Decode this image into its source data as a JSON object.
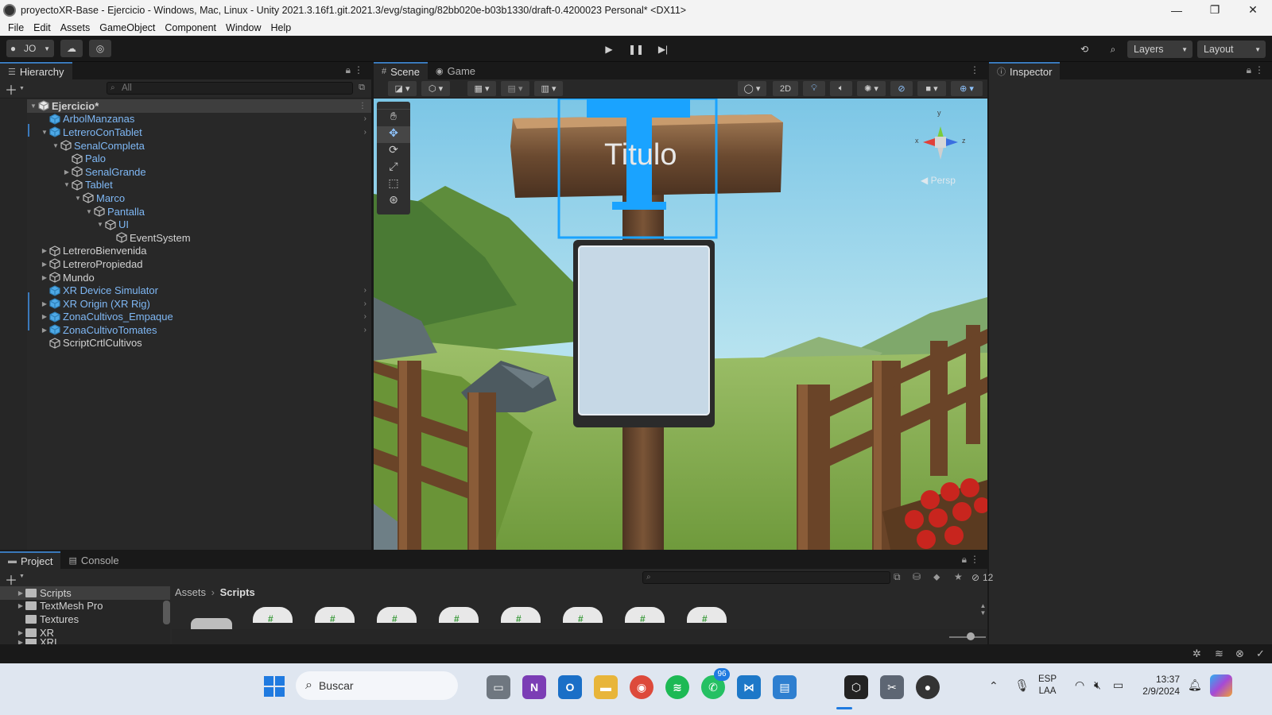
{
  "window": {
    "title": "proyectoXR-Base - Ejercicio - Windows, Mac, Linux - Unity 2021.3.16f1.git.2021.3/evg/staging/82bb020e-b03b1330/draft-0.4200023 Personal* <DX11>",
    "minimize": "—",
    "maximize": "❐",
    "close": "✕"
  },
  "menu": [
    "File",
    "Edit",
    "Assets",
    "GameObject",
    "Component",
    "Window",
    "Help"
  ],
  "toolbar": {
    "account": "JO",
    "layers": "Layers",
    "layout": "Layout"
  },
  "hierarchy": {
    "tab": "Hierarchy",
    "search_placeholder": "All",
    "items": [
      {
        "label": "Ejercicio*",
        "depth": 0,
        "arrow": "▼",
        "kind": "scene",
        "blue": false,
        "selected": true
      },
      {
        "label": "ArbolManzanas",
        "depth": 1,
        "arrow": "",
        "kind": "prefab",
        "blue": true,
        "chevron": true
      },
      {
        "label": "LetreroConTablet",
        "depth": 1,
        "arrow": "▼",
        "kind": "prefab",
        "blue": true,
        "chevron": true
      },
      {
        "label": "SenalCompleta",
        "depth": 2,
        "arrow": "▼",
        "kind": "obj",
        "blue": true
      },
      {
        "label": "Palo",
        "depth": 3,
        "arrow": "",
        "kind": "obj",
        "blue": true
      },
      {
        "label": "SenalGrande",
        "depth": 3,
        "arrow": "▶",
        "kind": "obj",
        "blue": true
      },
      {
        "label": "Tablet",
        "depth": 3,
        "arrow": "▼",
        "kind": "obj",
        "blue": true
      },
      {
        "label": "Marco",
        "depth": 4,
        "arrow": "▼",
        "kind": "obj",
        "blue": true
      },
      {
        "label": "Pantalla",
        "depth": 5,
        "arrow": "▼",
        "kind": "obj",
        "blue": true
      },
      {
        "label": "UI",
        "depth": 6,
        "arrow": "▼",
        "kind": "obj",
        "blue": true
      },
      {
        "label": "EventSystem",
        "depth": 7,
        "arrow": "",
        "kind": "obj",
        "blue": false
      },
      {
        "label": "LetreroBienvenida",
        "depth": 1,
        "arrow": "▶",
        "kind": "obj",
        "blue": false
      },
      {
        "label": "LetreroPropiedad",
        "depth": 1,
        "arrow": "▶",
        "kind": "obj",
        "blue": false
      },
      {
        "label": "Mundo",
        "depth": 1,
        "arrow": "▶",
        "kind": "obj",
        "blue": false
      },
      {
        "label": "XR Device Simulator",
        "depth": 1,
        "arrow": "",
        "kind": "prefab",
        "blue": true,
        "chevron": true
      },
      {
        "label": "XR Origin (XR Rig)",
        "depth": 1,
        "arrow": "▶",
        "kind": "prefab",
        "blue": true,
        "chevron": true
      },
      {
        "label": "ZonaCultivos_Empaque",
        "depth": 1,
        "arrow": "▶",
        "kind": "prefab",
        "blue": true,
        "chevron": true
      },
      {
        "label": "ZonaCultivoTomates",
        "depth": 1,
        "arrow": "▶",
        "kind": "prefab",
        "blue": true,
        "chevron": true
      },
      {
        "label": "ScriptCrtlCultivos",
        "depth": 1,
        "arrow": "",
        "kind": "obj",
        "blue": false
      }
    ]
  },
  "scene": {
    "tabs": [
      "Scene",
      "Game"
    ],
    "btn_2d": "2D",
    "sign_text": "Titulo",
    "persp": "◀ Persp",
    "gizmo_y": "y",
    "gizmo_z": "z",
    "gizmo_x": "x"
  },
  "inspector": {
    "tab": "Inspector"
  },
  "project": {
    "tabs": [
      "Project",
      "Console"
    ],
    "folders": [
      "Scripts",
      "TextMesh Pro",
      "Textures",
      "XR",
      "XRI"
    ],
    "breadcrumb": [
      "Assets",
      "Scripts"
    ],
    "hidden_count": "12"
  },
  "taskbar": {
    "search": "Buscar",
    "whatsapp_badge": "96",
    "lang1": "ESP",
    "lang2": "LAA",
    "time": "13:37",
    "date": "2/9/2024"
  },
  "colors": {
    "selection_blue": "#3a79bb",
    "prefab_blue": "#7fb8f5",
    "rect_tool": "#1aa3ff"
  }
}
